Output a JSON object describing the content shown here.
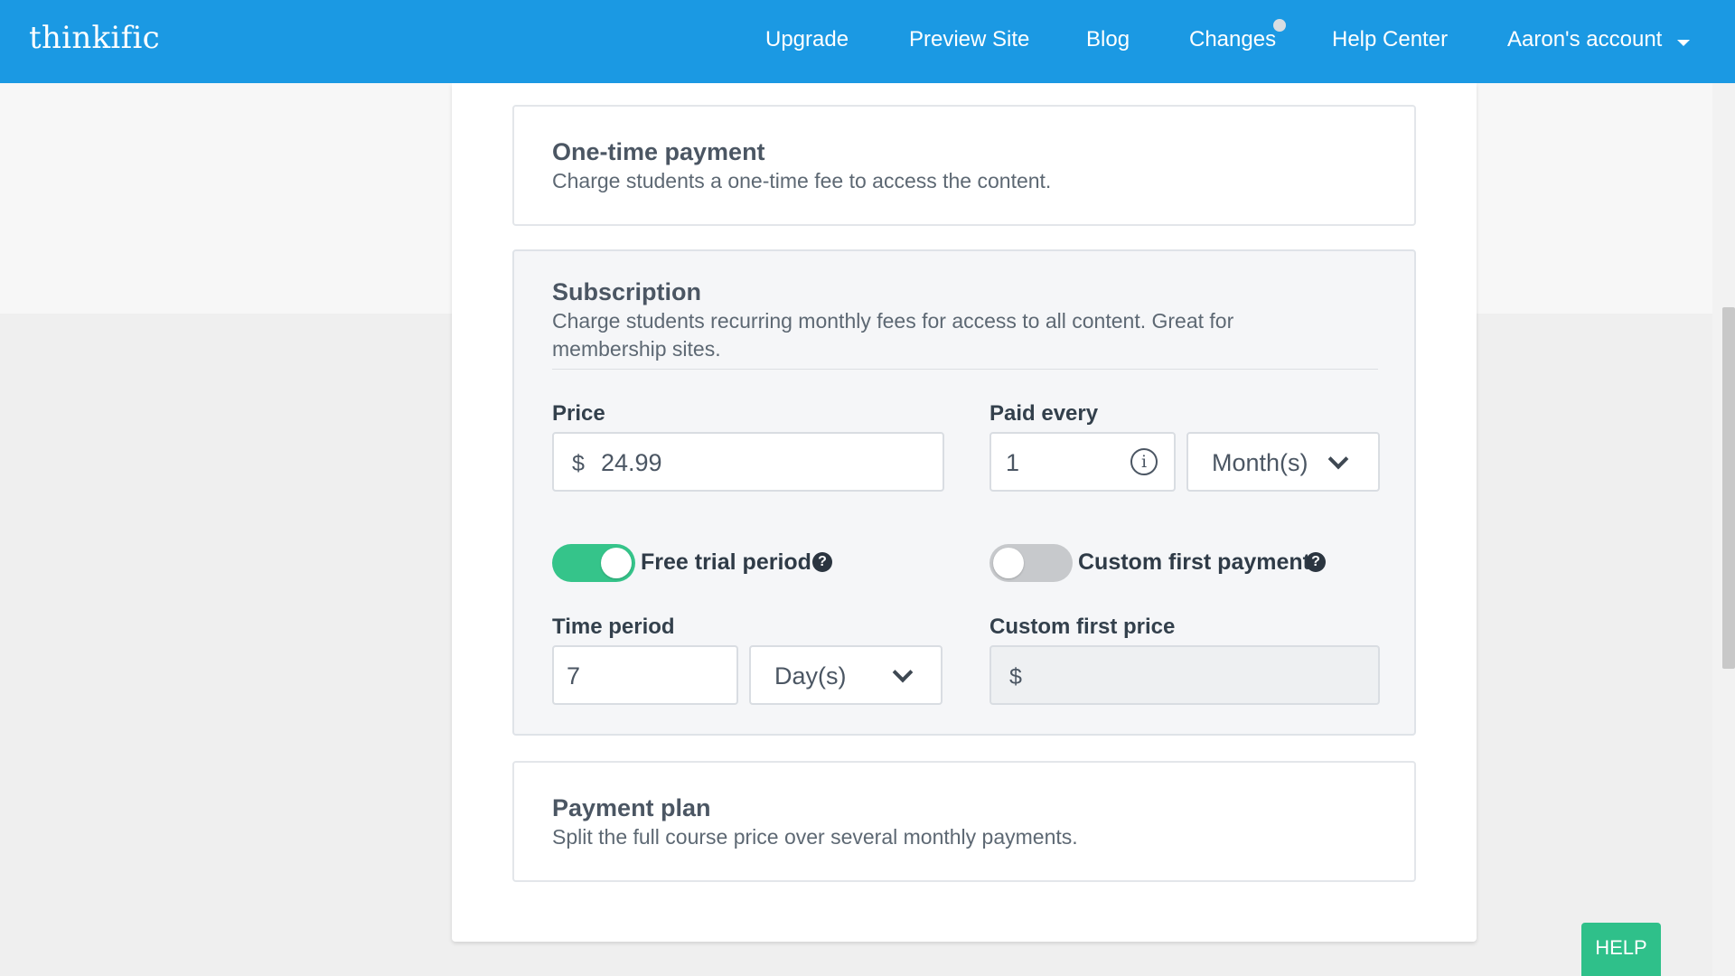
{
  "header": {
    "logo": "thinkific",
    "nav": {
      "upgrade": "Upgrade",
      "preview_site": "Preview Site",
      "blog": "Blog",
      "changes": "Changes",
      "help_center": "Help Center",
      "account": "Aaron's account"
    },
    "icons": {
      "changes_dot": "notification-dot-icon",
      "account_caret": "caret-down-icon"
    }
  },
  "options": {
    "one_time": {
      "title": "One-time payment",
      "description": "Charge students a one-time fee to access the content."
    },
    "subscription": {
      "title": "Subscription",
      "description_line1": "Charge students recurring monthly fees for access to all content. Great for",
      "description_line2": "membership sites.",
      "price_label": "Price",
      "price_currency": "$",
      "price_value": "24.99",
      "paid_every_label": "Paid every",
      "paid_every_value": "1",
      "paid_every_unit": "Month(s)",
      "free_trial": {
        "label": "Free trial period",
        "enabled": true
      },
      "custom_first_payment": {
        "label": "Custom first payment",
        "enabled": false
      },
      "time_period_label": "Time period",
      "time_period_value": "7",
      "time_period_unit": "Day(s)",
      "custom_first_price_label": "Custom first price",
      "custom_first_price_currency": "$",
      "help_glyph": "?",
      "info_glyph": "i"
    },
    "payment_plan": {
      "title": "Payment plan",
      "description": "Split the full course price over several monthly payments."
    }
  },
  "help_button": "HELP",
  "colors": {
    "header": "#1b99e3",
    "toggle_on": "#35c48a",
    "toggle_off": "#c7c9cc",
    "help_button": "#2fc08a"
  }
}
